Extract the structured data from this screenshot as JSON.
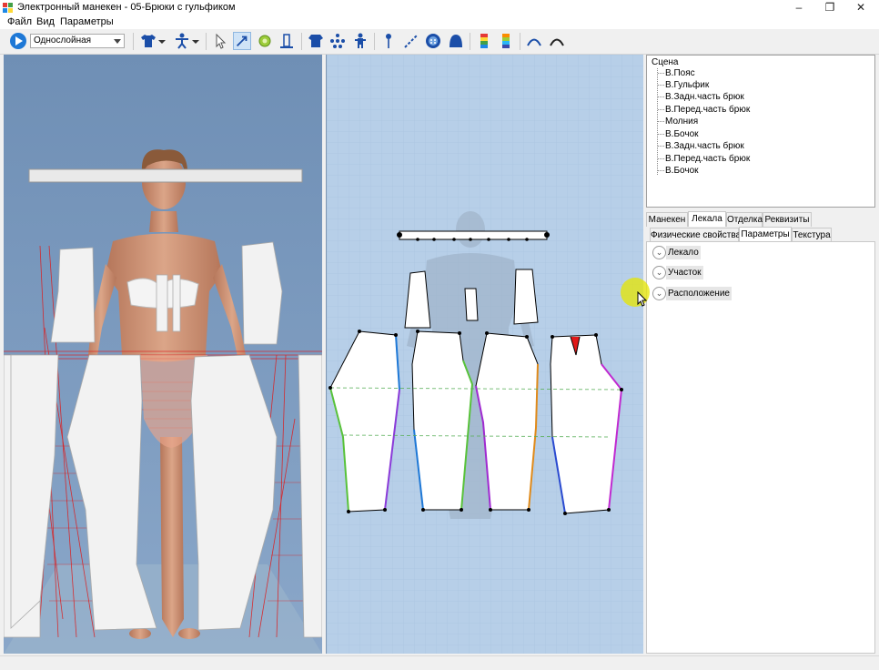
{
  "window": {
    "title": "Электронный манекен - 05-Брюки с гульфиком",
    "minimize": "–",
    "restore": "❐",
    "close": "✕"
  },
  "menu": {
    "items": [
      "Файл",
      "Вид",
      "Параметры"
    ]
  },
  "toolbar": {
    "layer_mode": "Однослойная",
    "icons": [
      "play-icon",
      "layer-mode-select",
      "shirt-icon",
      "mannequin-icon",
      "pointer-icon",
      "edit-arrow-icon",
      "sun-icon",
      "ruler-icon",
      "garment-icon",
      "joints-icon",
      "figure-icon",
      "pin-icon",
      "dashed-line-icon",
      "button-icon",
      "dome-icon",
      "color-scale-icon",
      "gradient-scale-icon",
      "arc-left-icon",
      "arc-right-icon"
    ]
  },
  "scene": {
    "root": "Сцена",
    "items": [
      "В.Пояс",
      "В.Гульфик",
      "В.Задн.часть брюк",
      "В.Перед.часть брюк",
      "Молния",
      "В.Бочок",
      "В.Задн.часть брюк",
      "В.Перед.часть брюк",
      "В.Бочок"
    ]
  },
  "main_tabs": [
    "Манекен",
    "Лекала",
    "Отделка",
    "Реквизиты"
  ],
  "main_tab_selected": "Лекала",
  "sub_tabs": [
    "Физические свойства",
    "Параметры",
    "Текстура"
  ],
  "sub_tab_selected": "Параметры",
  "groups": [
    "Лекало",
    "Участок",
    "Расположение"
  ],
  "colors": {
    "viewport_3d": "#6f8fb5",
    "viewport_2d": "#b7cfe8",
    "seam_red": "#e01818",
    "accent_blue": "#1e78d6"
  }
}
